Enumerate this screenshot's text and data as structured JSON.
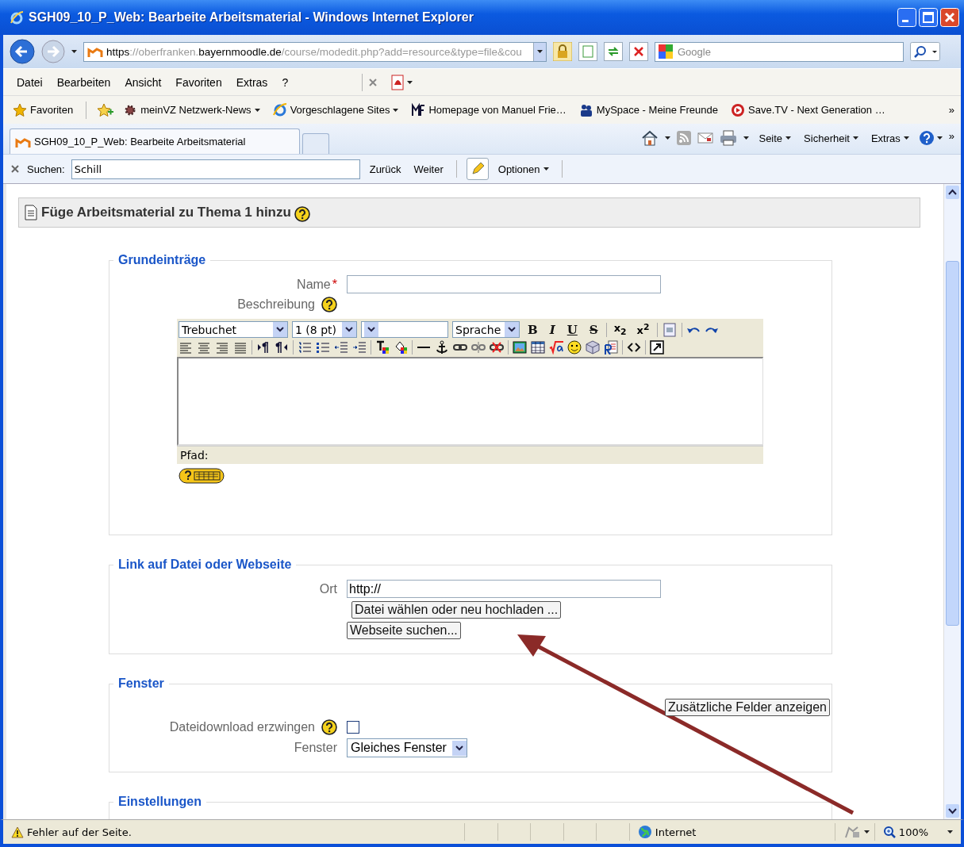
{
  "window": {
    "title": "SGH09_10_P_Web: Bearbeite Arbeitsmaterial - Windows Internet Explorer"
  },
  "address_bar": {
    "segments": [
      {
        "text": "https",
        "emphasis": true
      },
      {
        "text": "://oberfranken.",
        "emphasis": false
      },
      {
        "text": "bayernmoodle.de",
        "emphasis": true
      },
      {
        "text": "/course/modedit.php?add=resource&type=file&cou",
        "emphasis": false
      }
    ]
  },
  "search_box": {
    "placeholder": "Google"
  },
  "menu": [
    "Datei",
    "Bearbeiten",
    "Ansicht",
    "Favoriten",
    "Extras",
    "?"
  ],
  "favorites_bar": {
    "label": "Favoriten",
    "items": [
      {
        "label": "meinVZ Netzwerk-News",
        "dropdown": true
      },
      {
        "label": "Vorgeschlagene Sites",
        "dropdown": true
      },
      {
        "label": "Homepage von Manuel Frie…",
        "dropdown": false
      },
      {
        "label": "MySpace - Meine Freunde",
        "dropdown": false
      },
      {
        "label": "Save.TV - Next Generation …",
        "dropdown": false
      }
    ],
    "more": "»"
  },
  "tabs": [
    {
      "label": "SGH09_10_P_Web: Bearbeite Arbeitsmaterial",
      "selected": true
    }
  ],
  "command_bar": {
    "items": [
      "Seite",
      "Sicherheit",
      "Extras"
    ],
    "more": "»"
  },
  "find_bar": {
    "label": "Suchen:",
    "value": "Schill",
    "buttons": [
      "Zurück",
      "Weiter"
    ],
    "options": "Optionen"
  },
  "page": {
    "heading": "Füge Arbeitsmaterial zu Thema 1 hinzu",
    "sections": [
      {
        "legend": "Grundeinträge",
        "rows": [
          {
            "kind": "text",
            "label": "Name",
            "required_mark": "*"
          },
          {
            "kind": "label",
            "label": "Beschreibung",
            "help": true
          },
          {
            "kind": "editor",
            "font": "Trebuchet",
            "size": "1 (8 pt)",
            "language": "Sprache",
            "format_buttons": [
              "B",
              "I",
              "U",
              "S"
            ],
            "script_buttons": [
              "x$_{2}$",
              "x$^{2}$"
            ],
            "path_label": "Pfad:"
          }
        ]
      },
      {
        "legend": "Link auf Datei oder Webseite",
        "rows": [
          {
            "kind": "text",
            "label": "Ort",
            "value": "http://"
          },
          {
            "kind": "button",
            "label": "Datei wählen oder neu hochladen ..."
          },
          {
            "kind": "button",
            "label": "Webseite suchen..."
          }
        ]
      },
      {
        "legend": "Fenster",
        "rows": [
          {
            "kind": "right_button",
            "label": "Zusätzliche Felder anzeigen"
          },
          {
            "kind": "checkbox",
            "label": "Dateidownload erzwingen",
            "help": true,
            "checked": false
          },
          {
            "kind": "select",
            "label": "Fenster",
            "value": "Gleiches Fenster"
          }
        ]
      },
      {
        "legend": "Einstellungen"
      }
    ]
  },
  "status_bar": {
    "message": "Fehler auf der Seite.",
    "zone": "Internet",
    "zoom": "100%"
  }
}
